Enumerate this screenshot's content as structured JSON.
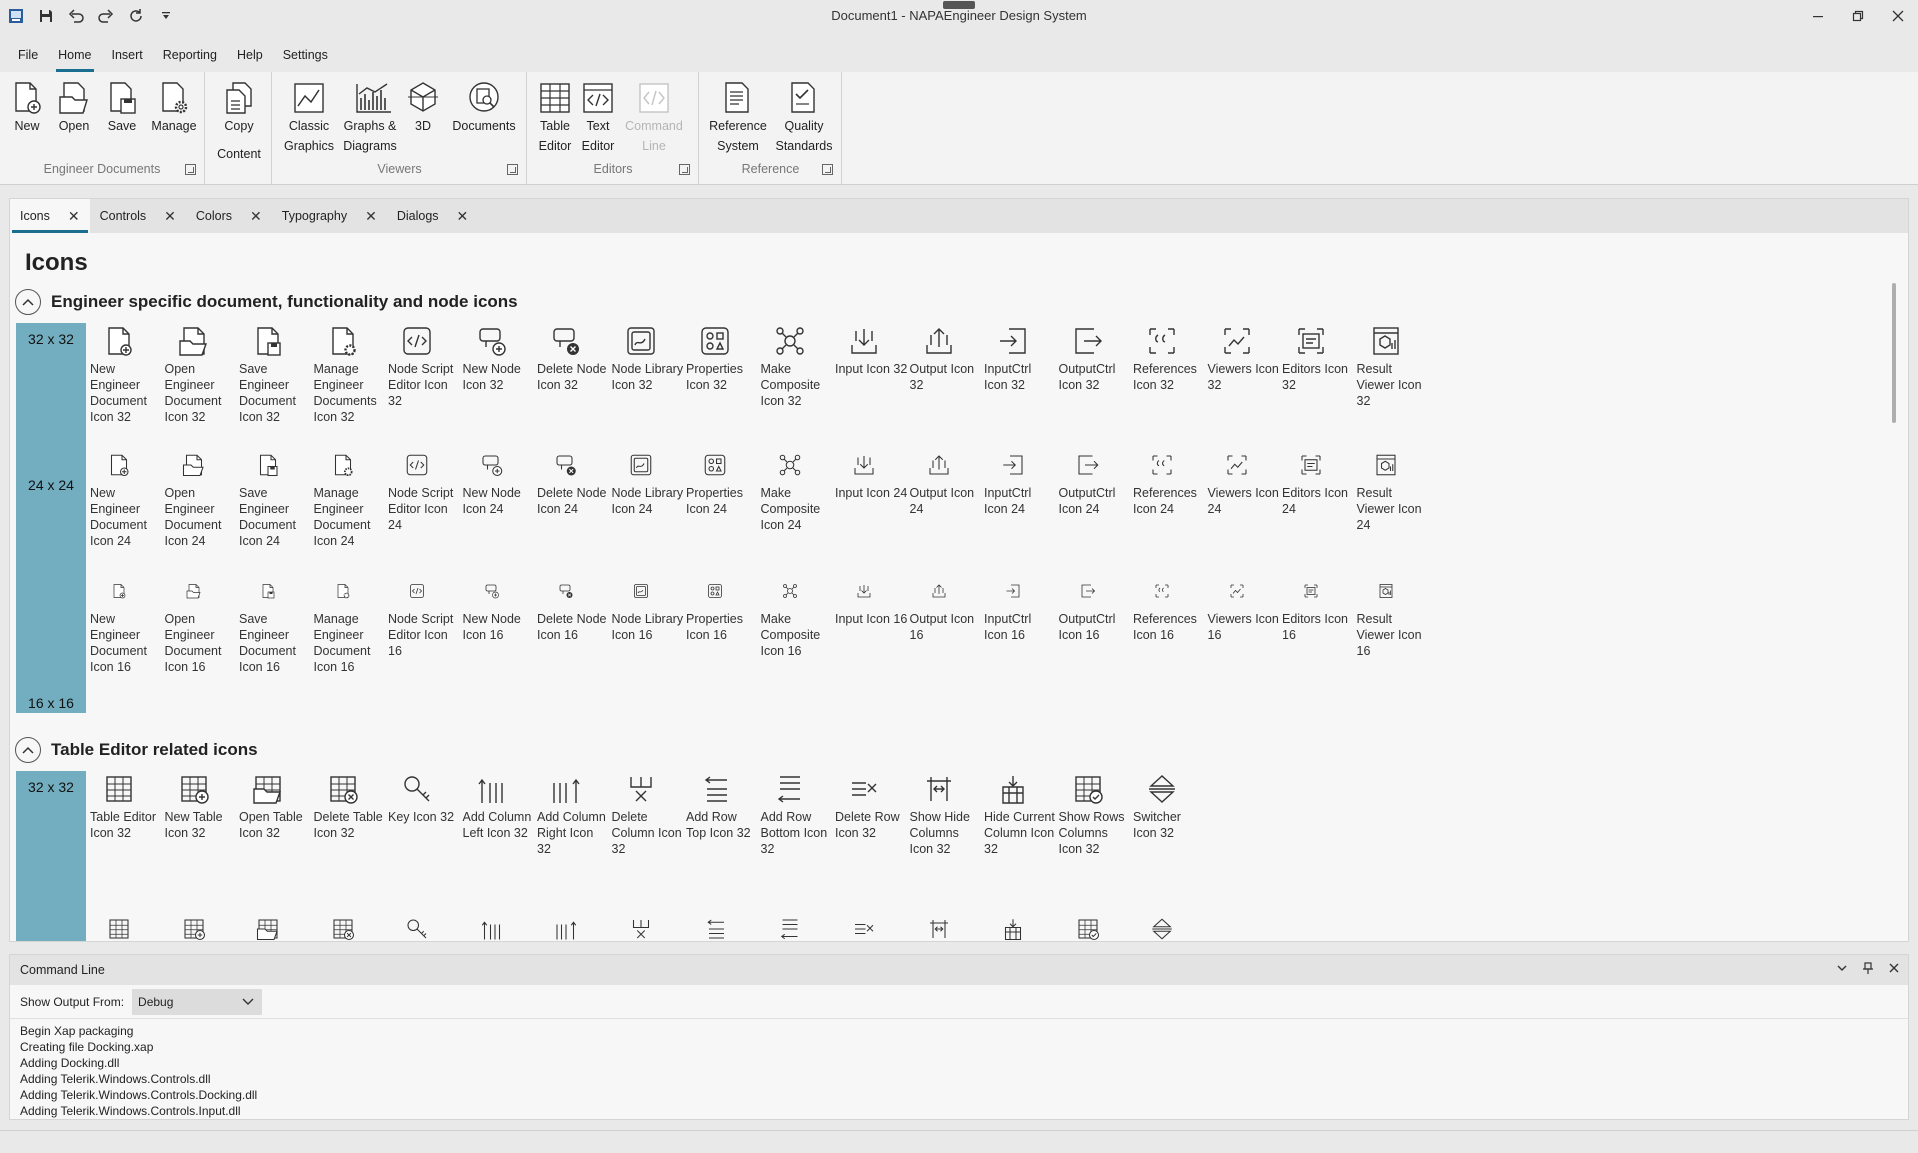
{
  "window": {
    "title": "Document1 - NAPAEngineer Design System"
  },
  "quick_access": [
    "app-icon",
    "save-icon",
    "undo-icon",
    "redo-icon",
    "refresh-icon",
    "customize-icon"
  ],
  "menu_tabs": [
    "File",
    "Home",
    "Insert",
    "Reporting",
    "Help",
    "Settings"
  ],
  "ribbon": {
    "groups": {
      "engineer_documents": {
        "name": "Engineer Documents",
        "buttons": [
          {
            "line1": "New",
            "line2": ""
          },
          {
            "line1": "Open",
            "line2": ""
          },
          {
            "line1": "Save",
            "line2": ""
          },
          {
            "line1": "Manage",
            "line2": ""
          }
        ]
      },
      "content": {
        "name": "",
        "buttons": [
          {
            "line1": "Copy",
            "line2": "Content"
          }
        ]
      },
      "viewers": {
        "name": "Viewers",
        "buttons": [
          {
            "line1": "Classic",
            "line2": "Graphics"
          },
          {
            "line1": "Graphs &",
            "line2": "Diagrams"
          },
          {
            "line1": "3D",
            "line2": ""
          },
          {
            "line1": "Documents",
            "line2": ""
          }
        ]
      },
      "editors": {
        "name": "Editors",
        "buttons": [
          {
            "line1": "Table",
            "line2": "Editor"
          },
          {
            "line1": "Text",
            "line2": "Editor"
          },
          {
            "line1": "Command",
            "line2": "Line"
          }
        ]
      },
      "reference": {
        "name": "Reference",
        "buttons": [
          {
            "line1": "Reference",
            "line2": "System"
          },
          {
            "line1": "Quality",
            "line2": "Standards"
          }
        ]
      }
    }
  },
  "doc_tabs": [
    "Icons",
    "Controls",
    "Colors",
    "Typography",
    "Dialogs"
  ],
  "page": {
    "title": "Icons",
    "sections": [
      {
        "title": "Engineer specific document, functionality and node icons",
        "sizes": [
          "32 x 32",
          "24 x 24",
          "16 x 16"
        ],
        "rows": [
          [
            "New Engineer Document Icon 32",
            "Open Engineer Document Icon 32",
            "Save Engineer Document Icon 32",
            "Manage Engineer Documents Icon 32",
            "Node Script Editor Icon 32",
            "New Node Icon 32",
            "Delete Node Icon 32",
            "Node Library Icon 32",
            "Properties Icon 32",
            "Make Composite Icon 32",
            "Input Icon 32",
            "Output Icon 32",
            "InputCtrl Icon 32",
            "OutputCtrl Icon 32",
            "References Icon 32",
            "Viewers Icon 32",
            "Editors Icon 32",
            "Result Viewer Icon 32"
          ],
          [
            "New Engineer Document Icon 24",
            "Open Engineer Document Icon 24",
            "Save Engineer Document Icon 24",
            "Manage Engineer Document Icon 24",
            "Node Script Editor Icon 24",
            "New Node Icon 24",
            "Delete Node Icon 24",
            "Node Library Icon 24",
            "Properties Icon 24",
            "Make Composite Icon 24",
            "Input Icon 24",
            "Output Icon 24",
            "InputCtrl Icon 24",
            "OutputCtrl Icon 24",
            "References Icon 24",
            "Viewers Icon 24",
            "Editors Icon 24",
            "Result Viewer Icon 24"
          ],
          [
            "New Engineer Document Icon 16",
            "Open Engineer Document Icon 16",
            "Save Engineer Document Icon 16",
            "Manage Engineer Document Icon 16",
            "Node Script Editor Icon 16",
            "New Node Icon 16",
            "Delete Node Icon 16",
            "Node Library Icon 16",
            "Properties Icon 16",
            "Make Composite Icon 16",
            "Input Icon 16",
            "Output Icon 16",
            "InputCtrl Icon 16",
            "OutputCtrl Icon 16",
            "References Icon 16",
            "Viewers Icon 16",
            "Editors Icon 16",
            "Result Viewer Icon 16"
          ]
        ]
      },
      {
        "title": "Table Editor related icons",
        "sizes": [
          "32 x 32"
        ],
        "rows": [
          [
            "Table Editor Icon 32",
            "New Table Icon 32",
            "Open Table Icon 32",
            "Delete Table Icon 32",
            "Key Icon 32",
            "Add Column Left Icon 32",
            "Add Column Right Icon 32",
            "Delete Column Icon 32",
            "Add Row Top Icon 32",
            "Add Row Bottom Icon 32",
            "Delete Row Icon 32",
            "Show Hide Columns Icon 32",
            "Hide Current Column Icon 32",
            "Show Rows Columns Icon 32",
            "Switcher Icon 32"
          ],
          [
            "",
            "",
            "",
            "",
            "",
            "",
            "",
            "",
            "",
            "",
            "",
            "",
            "",
            "",
            ""
          ]
        ]
      }
    ]
  },
  "command_line": {
    "title": "Command Line",
    "filter_label": "Show Output From:",
    "filter_value": "Debug",
    "log": [
      "Begin Xap packaging",
      "Creating file Docking.xap",
      "Adding Docking.dll",
      "Adding Telerik.Windows.Controls.dll",
      "Adding Telerik.Windows.Controls.Docking.dll",
      "Adding Telerik.Windows.Controls.Input.dll"
    ]
  },
  "colors": {
    "accent": "#1a6f91",
    "size_bar": "#73aec0"
  }
}
